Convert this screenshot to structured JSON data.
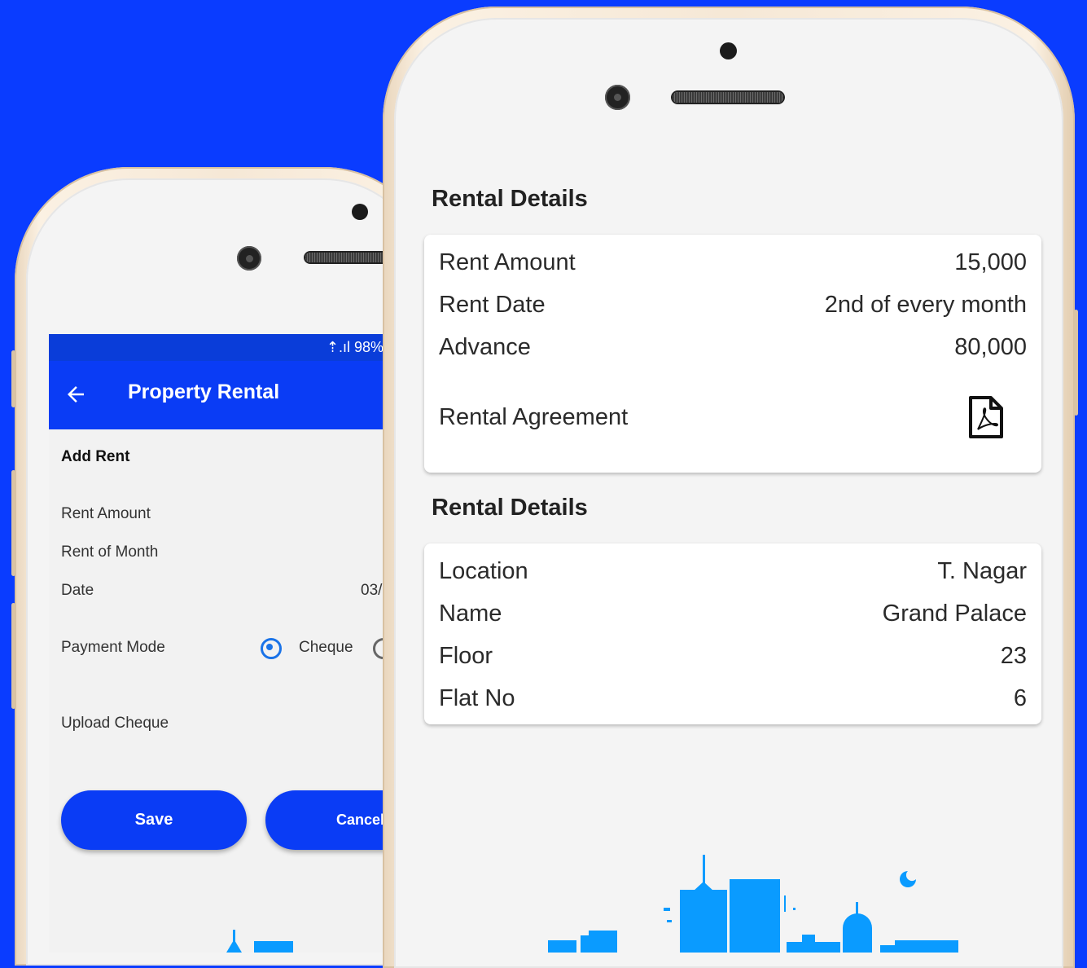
{
  "left_phone": {
    "status_bar": {
      "signal_text": "⇡.ıl 98%"
    },
    "app_bar": {
      "title": "Property Rental",
      "back_icon": "arrow-left-icon"
    },
    "form": {
      "heading": "Add Rent",
      "labels": {
        "rent_amount": "Rent Amount",
        "rent_of_month": "Rent of Month",
        "date": "Date",
        "payment_mode": "Payment Mode",
        "upload_cheque": "Upload Cheque"
      },
      "date_value": "03/",
      "payment_options": [
        {
          "label": "Cheque",
          "selected": true
        },
        {
          "label": "",
          "selected": false
        }
      ],
      "buttons": {
        "save": "Save",
        "cancel": "Cancel"
      }
    }
  },
  "right_phone": {
    "sections": [
      {
        "title": "Rental Details",
        "rows": [
          {
            "key": "Rent Amount",
            "value": "15,000"
          },
          {
            "key": "Rent Date",
            "value": "2nd of every month"
          },
          {
            "key": "Advance",
            "value": "80,000"
          },
          {
            "key": "Rental Agreement",
            "value_icon": "pdf-file-icon"
          }
        ]
      },
      {
        "title": "Rental Details",
        "rows": [
          {
            "key": "Location",
            "value": "T. Nagar"
          },
          {
            "key": "Name",
            "value": "Grand Palace"
          },
          {
            "key": "Floor",
            "value": "23"
          },
          {
            "key": "Flat No",
            "value": "6"
          }
        ]
      }
    ]
  },
  "colors": {
    "background": "#0a3cff",
    "app_bar": "#0a3cf5",
    "status_bar": "#0a3dd9",
    "skyline": "#0a9bff",
    "radio_accent": "#1a73e8"
  }
}
